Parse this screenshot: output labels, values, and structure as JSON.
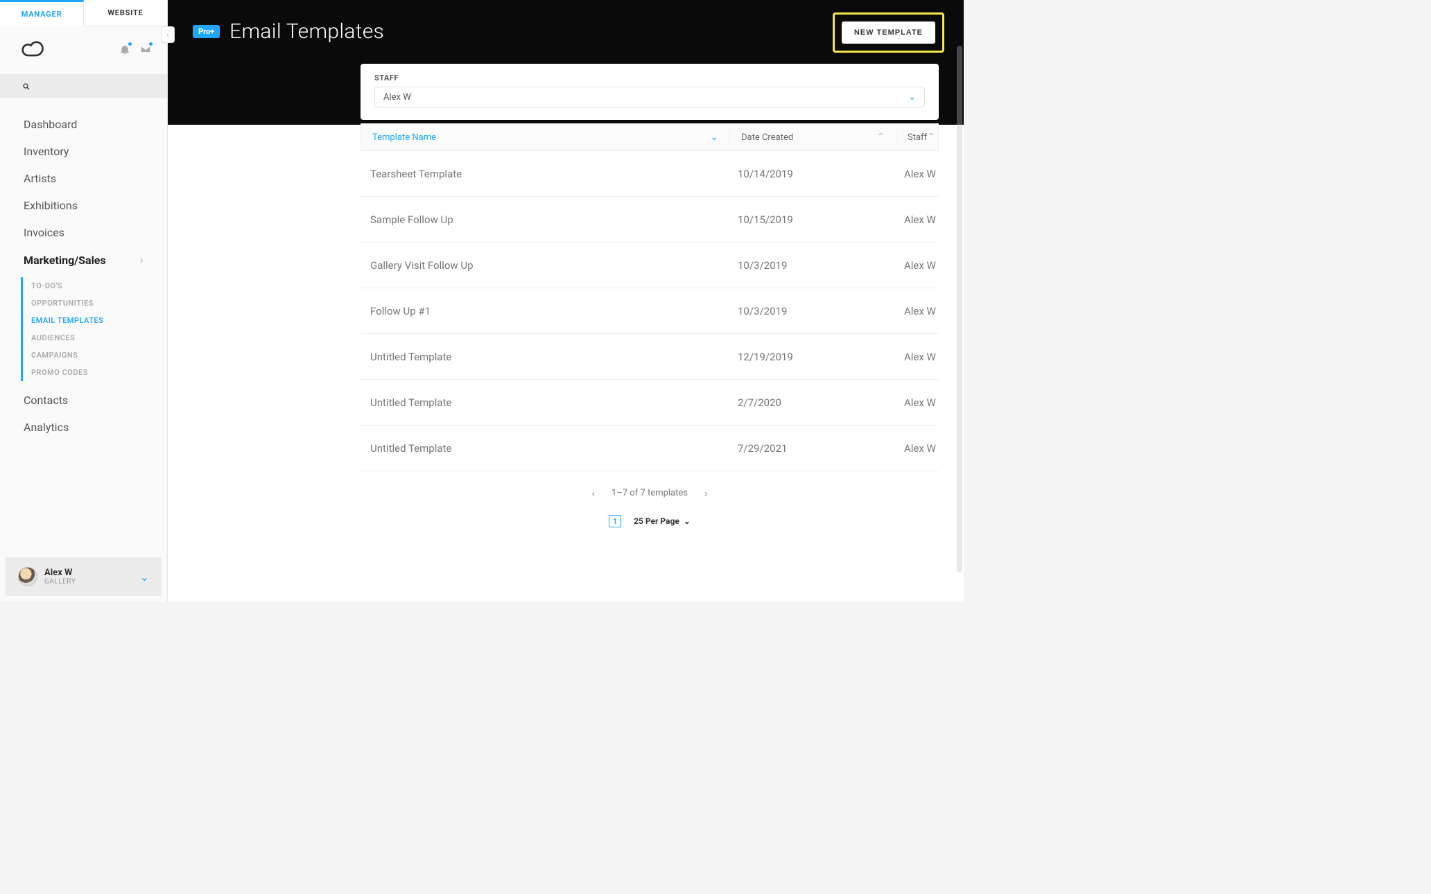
{
  "tabs": {
    "manager": "MANAGER",
    "website": "WEBSITE"
  },
  "sidebar": {
    "items": [
      "Dashboard",
      "Inventory",
      "Artists",
      "Exhibitions",
      "Invoices",
      "Marketing/Sales",
      "Contacts",
      "Analytics"
    ],
    "activeIndex": 5,
    "subItems": [
      "TO-DO'S",
      "OPPORTUNITIES",
      "EMAIL TEMPLATES",
      "AUDIENCES",
      "CAMPAIGNS",
      "PROMO CODES"
    ],
    "subActiveIndex": 2
  },
  "userFooter": {
    "name": "Alex W",
    "role": "GALLERY"
  },
  "header": {
    "badge": "Pro+",
    "title": "Email Templates",
    "newButton": "NEW TEMPLATE"
  },
  "filter": {
    "label": "STAFF",
    "value": "Alex W"
  },
  "table": {
    "columns": {
      "name": "Template Name",
      "date": "Date Created",
      "staff": "Staff"
    },
    "rows": [
      {
        "name": "Tearsheet Template",
        "date": "10/14/2019",
        "staff": "Alex W"
      },
      {
        "name": "Sample Follow Up",
        "date": "10/15/2019",
        "staff": "Alex W"
      },
      {
        "name": "Gallery Visit Follow Up",
        "date": "10/3/2019",
        "staff": "Alex W"
      },
      {
        "name": "Follow Up #1",
        "date": "10/3/2019",
        "staff": "Alex W"
      },
      {
        "name": "Untitled Template",
        "date": "12/19/2019",
        "staff": "Alex W"
      },
      {
        "name": "Untitled Template",
        "date": "2/7/2020",
        "staff": "Alex W"
      },
      {
        "name": "Untitled Template",
        "date": "7/29/2021",
        "staff": "Alex W"
      }
    ]
  },
  "pagination": {
    "range": "1–7 of 7 templates",
    "currentPage": "1",
    "perPage": "25 Per Page"
  }
}
